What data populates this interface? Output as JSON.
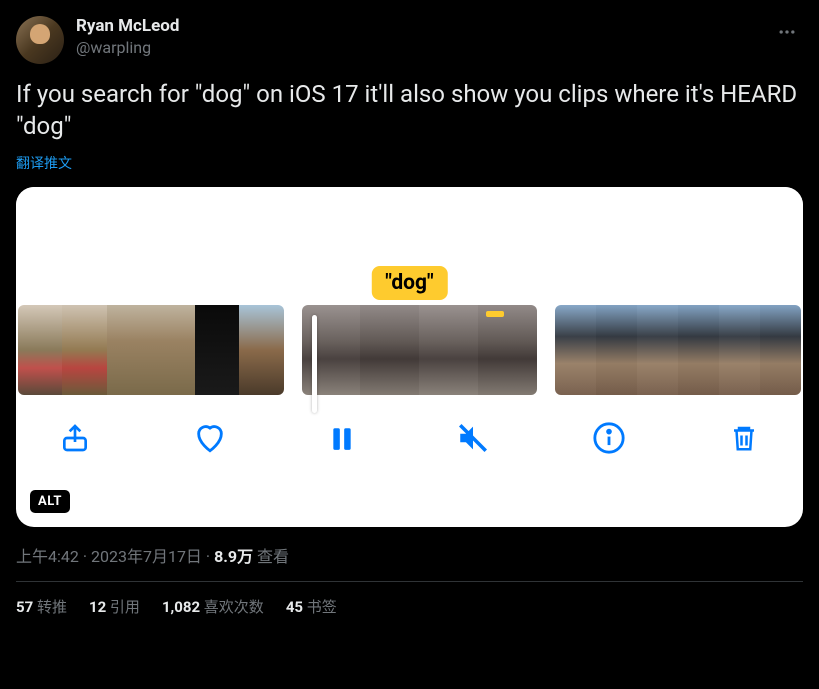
{
  "tweet": {
    "author": {
      "display_name": "Ryan McLeod",
      "username": "@warpling"
    },
    "text": "If you search for \"dog\" on iOS 17 it'll also show you clips where it's HEARD \"dog\"",
    "translate_label": "翻译推文",
    "media": {
      "caption_label": "\"dog\"",
      "alt_badge": "ALT"
    },
    "meta": {
      "time": "上午4:42",
      "date": "2023年7月17日",
      "views_count": "8.9万",
      "views_label": "查看"
    },
    "engagement": {
      "retweets_count": "57",
      "retweets_label": "转推",
      "quotes_count": "12",
      "quotes_label": "引用",
      "likes_count": "1,082",
      "likes_label": "喜欢次数",
      "bookmarks_count": "45",
      "bookmarks_label": "书签"
    }
  }
}
